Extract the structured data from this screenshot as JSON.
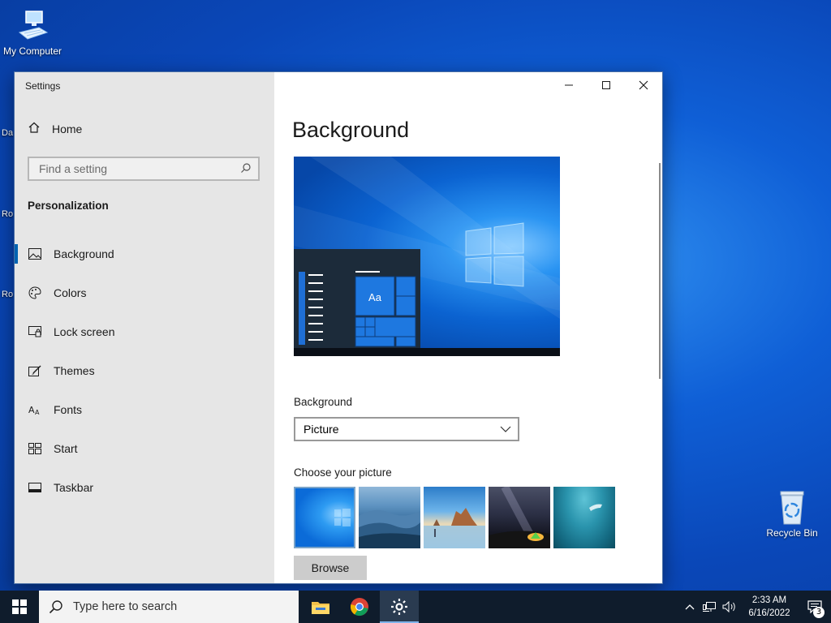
{
  "desktop": {
    "icons": [
      {
        "label": "My Computer"
      },
      {
        "label": "Recycle Bin"
      }
    ],
    "edge_labels": [
      "Da",
      "Ro",
      "Ro"
    ]
  },
  "window": {
    "title": "Settings",
    "sidebar": {
      "home_label": "Home",
      "search_placeholder": "Find a setting",
      "section": "Personalization",
      "items": [
        {
          "label": "Background",
          "icon": "picture-icon",
          "active": true
        },
        {
          "label": "Colors",
          "icon": "palette-icon"
        },
        {
          "label": "Lock screen",
          "icon": "lock-screen-icon"
        },
        {
          "label": "Themes",
          "icon": "brush-icon"
        },
        {
          "label": "Fonts",
          "icon": "font-icon"
        },
        {
          "label": "Start",
          "icon": "start-tiles-icon"
        },
        {
          "label": "Taskbar",
          "icon": "taskbar-icon"
        }
      ]
    },
    "content": {
      "page_title": "Background",
      "preview_tile_text": "Aa",
      "background_label": "Background",
      "background_value": "Picture",
      "choose_label": "Choose your picture",
      "browse_label": "Browse"
    }
  },
  "taskbar": {
    "search_placeholder": "Type here to search",
    "pinned": [
      "file-explorer-icon",
      "chrome-icon",
      "settings-gear-icon"
    ],
    "clock_time": "2:33 AM",
    "clock_date": "6/16/2022",
    "notification_count": "3"
  },
  "colors": {
    "accent": "#0063b1",
    "desktop_blue": "#0a47b8",
    "sidebar_bg": "#e6e6e6",
    "taskbar_bg": "#0f1c2c"
  }
}
